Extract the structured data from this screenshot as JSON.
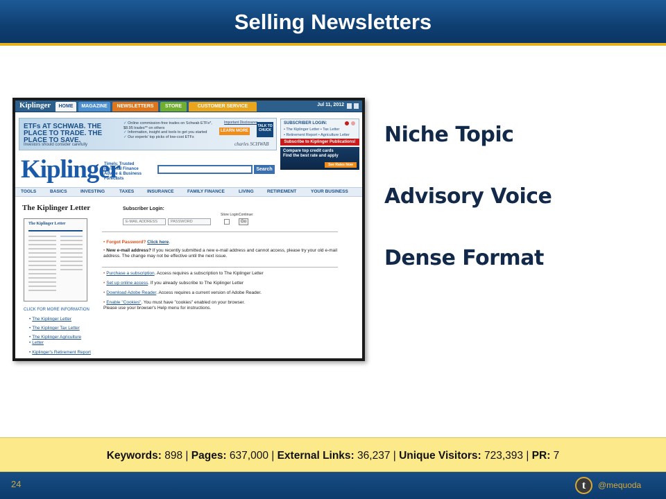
{
  "slide": {
    "title": "Selling Newsletters",
    "page_number": "24",
    "handle": "@mequoda"
  },
  "points": [
    "Niche Topic",
    "Advisory Voice",
    "Dense Format"
  ],
  "stats": {
    "keywords_label": "Keywords:",
    "keywords_value": "898",
    "pages_label": "Pages:",
    "pages_value": "637,000",
    "external_links_label": "External Links:",
    "external_links_value": "36,237",
    "unique_visitors_label": "Unique Visitors:",
    "unique_visitors_value": "723,393",
    "pr_label": "PR:",
    "pr_value": "7",
    "background_color": "#fbe98a"
  },
  "screenshot": {
    "mini_logo": "Kiplinger",
    "tabs": [
      "HOME",
      "MAGAZINE",
      "NEWSLETTERS",
      "STORE",
      "CUSTOMER SERVICE"
    ],
    "date": "Jul 11, 2012",
    "ad": {
      "headline": "ETFs AT SCHWAB. THE PLACE TO TRADE. THE PLACE TO SAVE.",
      "note": "Investors should consider carefully",
      "bullets": [
        "Online commission-free trades on Schwab ETFs*, $8.95 trades** on others",
        "Information, insight and tools to get you started",
        "Our experts' top picks of low-cost ETFs"
      ],
      "disclosure": "Important Disclosures",
      "cta": "LEARN MORE",
      "talk": "TALK TO CHUCK",
      "brand": "charles SCHWAB"
    },
    "logo": "Kiplinger",
    "tagline": "Timely, Trusted Personal Finance Advice & Business Forecasts",
    "search_button": "Search",
    "subscriber_box": {
      "title": "SUBSCRIBER LOGIN:",
      "line1": "• The Kiplinger Letter • Tax Letter",
      "line2": "• Retirement Report • Agriculture Letter"
    },
    "subscribe_banner": "Subscribe to Kiplinger Publications!",
    "credit_ad": {
      "line1": "Compare top credit cards",
      "line2": "Find the best rate and apply",
      "button": "See Rates Now"
    },
    "nav": [
      "TOOLS",
      "BASICS",
      "INVESTING",
      "TAXES",
      "INSURANCE",
      "FAMILY FINANCE",
      "LIVING",
      "RETIREMENT",
      "YOUR BUSINESS"
    ],
    "letter_title": "The Kiplinger Letter",
    "thumb_title": "The Kiplinger Letter",
    "more_info_title": "CLICK FOR MORE INFORMATION",
    "more_links": [
      "The Kiplinger Letter",
      "The Kiplinger Tax Letter",
      "The Kiplinger Agriculture",
      "Letter",
      "Kiplinger's Retirement Report"
    ],
    "login": {
      "label": "Subscriber Login:",
      "email_placeholder": "E-MAIL ADDRESS",
      "password_placeholder": "PASSWORD",
      "store_login": "Store Login:",
      "continue": "Continue:",
      "go": "Go"
    },
    "forgot": {
      "text": "Forgot Password?",
      "link": "Click here",
      "end": "."
    },
    "new_email": {
      "bold": "New e-mail address?",
      "text": " If you recently submitted a new e-mail address and cannot access, please try your old e-mail address. The change may not be effective until the next issue."
    },
    "purchase": {
      "link": "Purchase a subscription",
      "text": ". Access requires a subscription to The Kiplinger Letter"
    },
    "setup": {
      "link": "Set up online access",
      "text": ". If you already subscribe to The Kiplinger Letter"
    },
    "adobe": {
      "link": "Download Adobe Reader",
      "text": ". Access requires a current version of Adobe Reader."
    },
    "cookies": {
      "link": "Enable \"Cookies\"",
      "text": ". You must have \"cookies\" enabled on your browser.",
      "line2": "Please use your browser's Help menu for instructions."
    }
  }
}
